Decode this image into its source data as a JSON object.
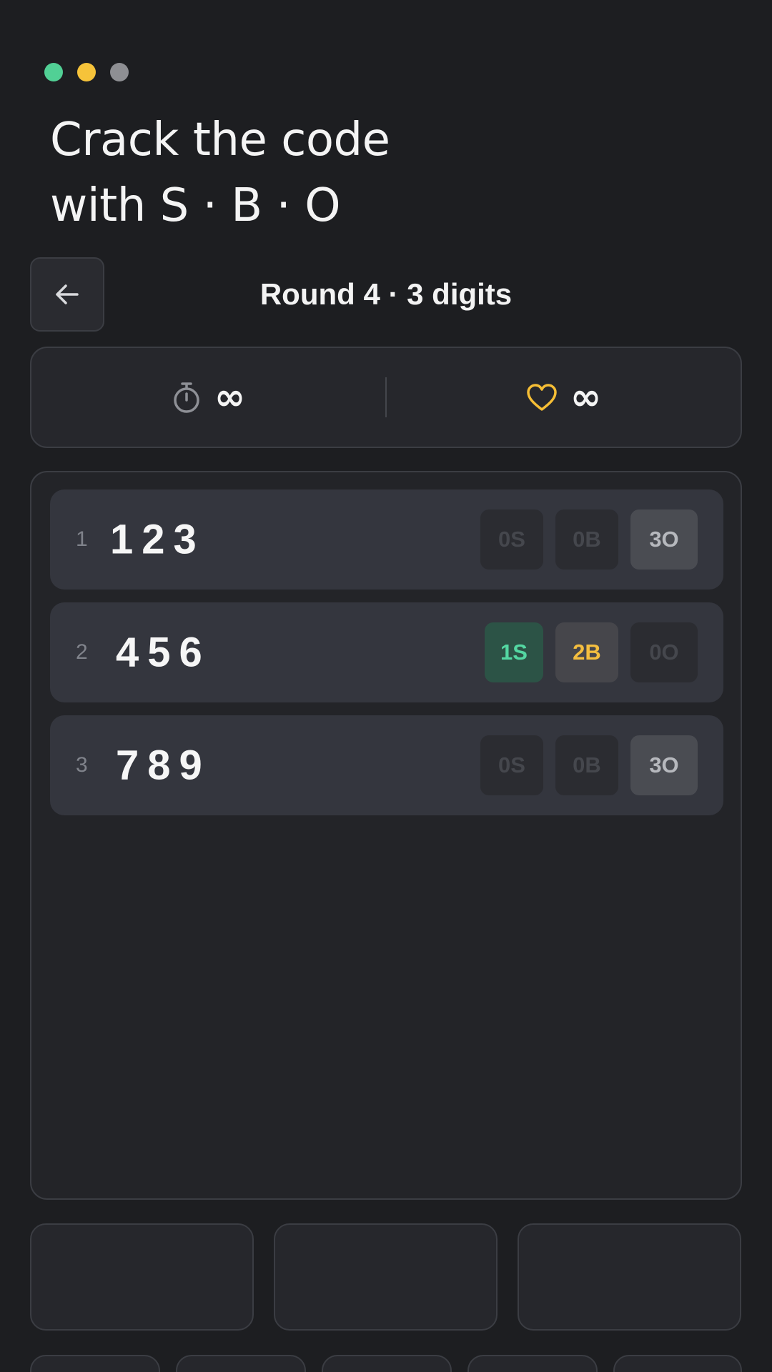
{
  "window_controls": [
    {
      "name": "green-dot",
      "color": "#51d095"
    },
    {
      "name": "yellow-dot",
      "color": "#f6c33a"
    },
    {
      "name": "gray-dot",
      "color": "#8e8f93"
    }
  ],
  "headline": {
    "line1": "Crack the code",
    "line2": "with S · B · O"
  },
  "header": {
    "back_icon": "arrow-left-icon",
    "title": "Round 4 · 3 digits"
  },
  "stats": {
    "timer_icon": "stopwatch-icon",
    "timer_value": "∞",
    "lives_icon": "heart-icon",
    "lives_value": "∞",
    "lives_color": "#f6be35"
  },
  "guesses": [
    {
      "num": "1",
      "code": "123",
      "strike": "0S",
      "ball": "0B",
      "out": "3O",
      "active": "out"
    },
    {
      "num": "2",
      "code": "456",
      "strike": "1S",
      "ball": "2B",
      "out": "0O",
      "active": "strike-ball"
    },
    {
      "num": "3",
      "code": "789",
      "strike": "0S",
      "ball": "0B",
      "out": "3O",
      "active": "out"
    }
  ],
  "colors": {
    "strike": "#54d7a2",
    "ball": "#f4be3f",
    "background": "#1d1e21"
  }
}
